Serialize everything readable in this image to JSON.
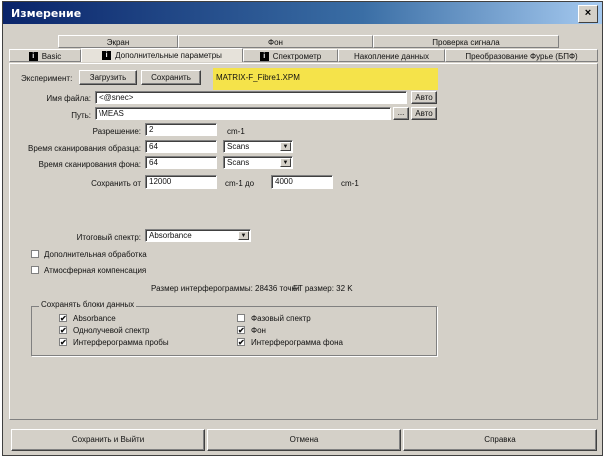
{
  "window": {
    "title": "Измерение",
    "close_glyph": "×"
  },
  "tabs_row1": [
    {
      "label": "Экран"
    },
    {
      "label": "Фон"
    },
    {
      "label": "Проверка сигнала"
    }
  ],
  "tabs_row2": [
    {
      "label": "Basic",
      "icon": "info-icon",
      "active": false
    },
    {
      "label": "Дополнительные параметры",
      "icon": "info-icon",
      "active": true
    },
    {
      "label": "Спектрометр",
      "icon": "info-icon",
      "active": false
    },
    {
      "label": "Накопление данных",
      "active": false
    },
    {
      "label": "Преобразование Фурье (БПФ)",
      "active": false
    }
  ],
  "icon_glyph": "i",
  "experiment": {
    "label": "Эксперимент:",
    "load_button": "Загрузить",
    "save_button": "Сохранить",
    "filename": "MATRIX-F_Fibre1.XPM"
  },
  "file_name": {
    "label": "Имя файла:",
    "value": "<@snec>",
    "auto_button": "Авто"
  },
  "path": {
    "label": "Путь:",
    "value": "\\MEAS",
    "browse_button": "...",
    "auto_button": "Авто"
  },
  "resolution": {
    "label": "Разрешение:",
    "value": "2",
    "unit": "cm-1"
  },
  "sample_scan": {
    "label": "Время сканирования образца:",
    "value": "64",
    "unit": "Scans"
  },
  "bg_scan": {
    "label": "Время сканирования фона:",
    "value": "64",
    "unit": "Scans"
  },
  "save_from": {
    "label": "Сохранить от",
    "from": "12000",
    "mid_unit": "cm-1 до",
    "to": "4000",
    "unit": "cm-1"
  },
  "result_spectrum": {
    "label": "Итоговый спектр:",
    "value": "Absorbance"
  },
  "additional_processing": {
    "label": "Дополнительная обработка",
    "checked": false
  },
  "atmos_comp": {
    "label": "Атмосферная компенсация",
    "checked": false
  },
  "interferogram_size": {
    "label": "Размер интерферограммы: 28436 точки"
  },
  "ft_size": {
    "label": "FT размер: 32 K"
  },
  "save_blocks": {
    "title": "Сохранять блоки данных",
    "left": [
      {
        "label": "Absorbance",
        "checked": true
      },
      {
        "label": "Однолучевой спектр",
        "checked": true
      },
      {
        "label": "Интерферограмма пробы",
        "checked": true
      }
    ],
    "right": [
      {
        "label": "Фазовый спектр",
        "checked": false
      },
      {
        "label": "Фон",
        "checked": true
      },
      {
        "label": "Интерферограмма фона",
        "checked": true
      }
    ]
  },
  "check_glyph": "✔",
  "dropdown_glyph": "▼",
  "footer": {
    "save_exit": "Сохранить и Выйти",
    "cancel": "Отмена",
    "help": "Справка"
  }
}
